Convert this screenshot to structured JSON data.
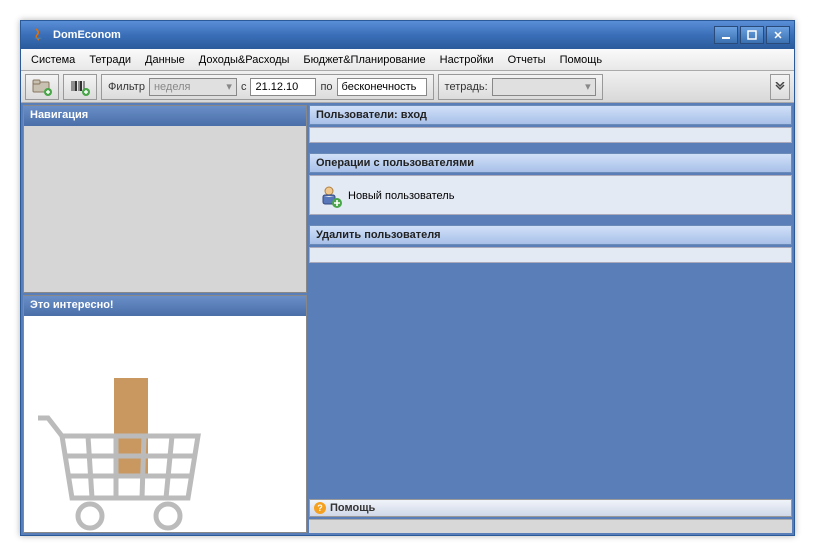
{
  "window": {
    "title": "DomEconom"
  },
  "menu": {
    "items": [
      {
        "label": "Система"
      },
      {
        "label": "Тетради"
      },
      {
        "label": "Данные"
      },
      {
        "label": "Доходы&Расходы"
      },
      {
        "label": "Бюджет&Планирование"
      },
      {
        "label": "Настройки"
      },
      {
        "label": "Отчеты"
      },
      {
        "label": "Помощь"
      }
    ]
  },
  "toolbar": {
    "filter_label": "Фильтр",
    "filter_value": "неделя",
    "from_label": "с",
    "from_date": "21.12.10",
    "to_label": "по",
    "to_value": "бесконечность",
    "notebook_label": "тетрадь:"
  },
  "sidebar": {
    "navigation_title": "Навигация",
    "interesting_title": "Это интересно!"
  },
  "sections": {
    "login_title": "Пользователи: вход",
    "ops_title": "Операции с пользователями",
    "new_user_label": "Новый пользователь",
    "delete_user_title": "Удалить пользователя"
  },
  "help": {
    "label": "Помощь"
  }
}
